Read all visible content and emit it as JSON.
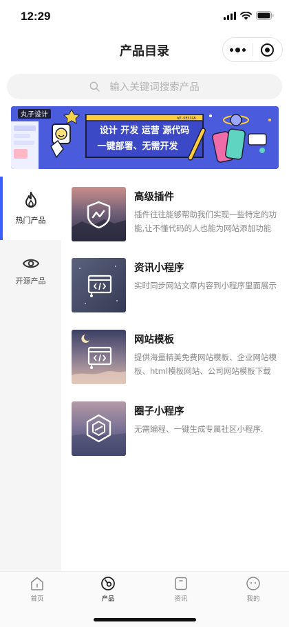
{
  "status": {
    "time": "12:29"
  },
  "nav": {
    "title": "产品目录"
  },
  "search": {
    "placeholder": "输入关键词搜索产品"
  },
  "banner": {
    "logo": "丸子设计",
    "tag": "WZ-DESIGN",
    "line1": "设计 开发 运营 源代码",
    "line2": "一键部署、无需开发"
  },
  "categories": [
    {
      "label": "热门产品",
      "icon": "flame-icon",
      "active": true
    },
    {
      "label": "开源产品",
      "icon": "eye-icon",
      "active": false
    }
  ],
  "products": [
    {
      "name": "高级插件",
      "desc": "插件往往能够帮助我们实现一些特定的功能,让不懂代码的人也能为网站添加功能",
      "icon": "shield-chart-icon"
    },
    {
      "name": "资讯小程序",
      "desc": "实时同步网站文章内容到小程序里面展示",
      "icon": "code-window-icon"
    },
    {
      "name": "网站模板",
      "desc": "提供海量精美免费网站模板、企业网站模板、html模板网站、公司网站模板下载",
      "icon": "code-window-icon"
    },
    {
      "name": "圈子小程序",
      "desc": "无需编程、一键生成专属社区小程序.",
      "icon": "hexagon-icon"
    }
  ],
  "tabs": [
    {
      "label": "首页",
      "icon": "home-icon",
      "active": false
    },
    {
      "label": "产品",
      "icon": "product-icon",
      "active": true
    },
    {
      "label": "资讯",
      "icon": "news-icon",
      "active": false
    },
    {
      "label": "我的",
      "icon": "profile-icon",
      "active": false
    }
  ],
  "colors": {
    "accent": "#3a60ff",
    "banner_bg": "#4a5bdc",
    "banner_accent": "#f5d547"
  }
}
